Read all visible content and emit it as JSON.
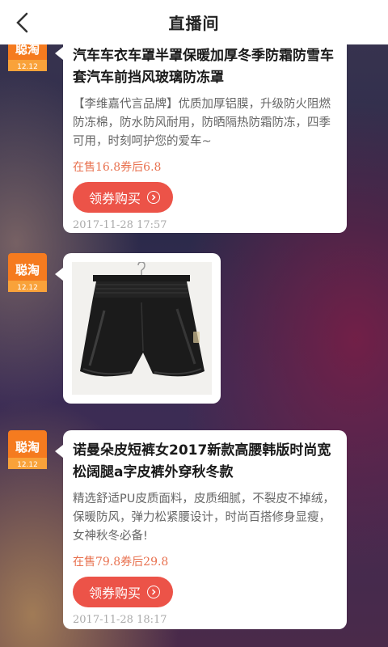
{
  "header": {
    "title": "直播间"
  },
  "avatar": {
    "brand": "聪淘",
    "date": "12.12"
  },
  "messages": [
    {
      "title": "汽车车衣车罩半罩保暖加厚冬季防霜防雪车套汽车前挡风玻璃防冻罩",
      "desc": "【李维嘉代言品牌】优质加厚铝膜，升级防火阻燃防冻棉，防水防风耐用，防晒隔热防霜防冻，四季可用，时刻呵护您的爱车~",
      "price": "在售16.8券后6.8",
      "button": "领券购买",
      "time": "2017-11-28 17:57"
    },
    {
      "image": "product-image-leather-shorts"
    },
    {
      "title": "诺曼朵皮短裤女2017新款高腰韩版时尚宽松阔腿a字皮裤外穿秋冬款",
      "desc": "精选舒适PU皮质面料，皮质细腻，不裂皮不掉绒，保暖防风，弹力松紧腰设计，时尚百搭修身显瘦，女神秋冬必备!",
      "price": "在售79.8券后29.8",
      "button": "领券购买",
      "time": "2017-11-28 18:17"
    }
  ]
}
